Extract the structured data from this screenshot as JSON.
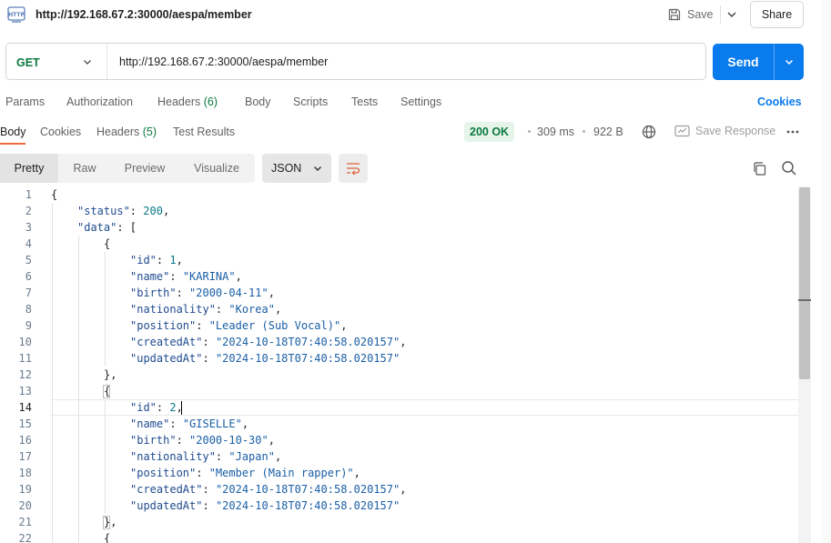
{
  "request": {
    "title": "http://192.168.67.2:30000/aespa/member",
    "save_label": "Save",
    "share_label": "Share",
    "method": "GET",
    "url": "http://192.168.67.2:30000/aespa/member",
    "send_label": "Send"
  },
  "request_tabs": {
    "params": "Params",
    "authorization": "Authorization",
    "headers": "Headers",
    "headers_count": "(6)",
    "body": "Body",
    "scripts": "Scripts",
    "tests": "Tests",
    "settings": "Settings",
    "cookies": "Cookies"
  },
  "response_tabs": {
    "body": "Body",
    "cookies": "Cookies",
    "headers": "Headers",
    "headers_count": "(5)",
    "test_results": "Test Results",
    "status": "200 OK",
    "time": "309 ms",
    "size": "922 B",
    "save_response": "Save Response"
  },
  "format_bar": {
    "pretty": "Pretty",
    "raw": "Raw",
    "preview": "Preview",
    "visualize": "Visualize",
    "format": "JSON"
  },
  "editor": {
    "current_line": 14,
    "lines": [
      "1",
      "2",
      "3",
      "4",
      "5",
      "6",
      "7",
      "8",
      "9",
      "10",
      "11",
      "12",
      "13",
      "14",
      "15",
      "16",
      "17",
      "18",
      "19",
      "20",
      "21",
      "22"
    ],
    "data": {
      "status_key": "\"status\"",
      "status_val": "200",
      "data_key": "\"data\"",
      "id_key": "\"id\"",
      "name_key": "\"name\"",
      "birth_key": "\"birth\"",
      "nationality_key": "\"nationality\"",
      "position_key": "\"position\"",
      "createdAt_key": "\"createdAt\"",
      "updatedAt_key": "\"updatedAt\"",
      "m1": {
        "id": "1",
        "name": "\"KARINA\"",
        "birth": "\"2000-04-11\"",
        "nationality": "\"Korea\"",
        "position": "\"Leader (Sub Vocal)\"",
        "createdAt": "\"2024-10-18T07:40:58.020157\"",
        "updatedAt": "\"2024-10-18T07:40:58.020157\""
      },
      "m2": {
        "id": "2",
        "name": "\"GISELLE\"",
        "birth": "\"2000-10-30\"",
        "nationality": "\"Japan\"",
        "position": "\"Member (Main rapper)\"",
        "createdAt": "\"2024-10-18T07:40:58.020157\"",
        "updatedAt": "\"2024-10-18T07:40:58.020157\""
      }
    }
  },
  "colors": {
    "send": "#097bed",
    "status_ok": "#0b7a3e",
    "active_tab_underline": "#f26b3a",
    "cookies_link": "#097bed"
  },
  "icons": {
    "app": "http-icon",
    "save": "save-icon",
    "globe": "globe-icon",
    "copy": "copy-icon",
    "search": "search-icon",
    "wrap": "wrap-lines-icon",
    "more": "more-icon"
  }
}
